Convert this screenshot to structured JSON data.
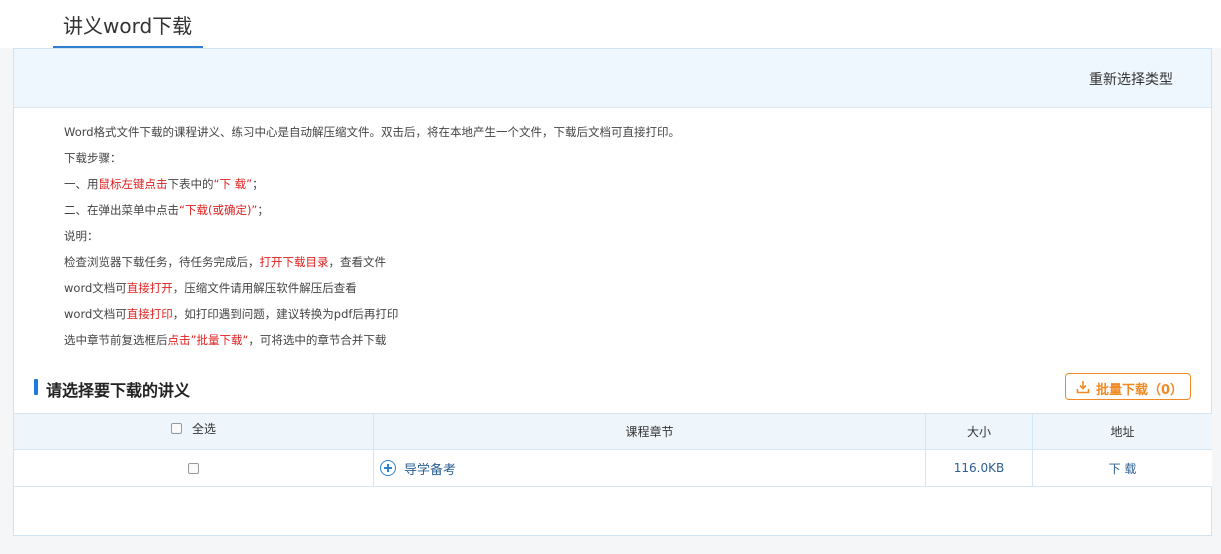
{
  "page": {
    "tab_title": "讲义word下载"
  },
  "header": {
    "reselect_label": "重新选择类型"
  },
  "notes": {
    "intro": "Word格式文件下载的课程讲义、练习中心是自动解压缩文件。双击后，将在本地产生一个文件，下载后文档可直接打印。",
    "steps_title": "下载步骤：",
    "step1_a": "一、用",
    "step1_red": "鼠标左键点击",
    "step1_b": "下表中的",
    "step1_red2": "“下 载”",
    "step1_c": "；",
    "step2_a": "二、在弹出菜单中点击",
    "step2_red": "“下载(或确定)”",
    "step2_b": "；",
    "explain_title": "说明：",
    "explain1_a": "检查浏览器下载任务，待任务完成后，",
    "explain1_red": "打开下载目录",
    "explain1_b": "，查看文件",
    "explain2_a": "word文档可",
    "explain2_red": "直接打开",
    "explain2_b": "，压缩文件请用解压软件解压后查看",
    "explain3_a": "word文档可",
    "explain3_red": "直接打印",
    "explain3_b": "，如打印遇到问题，建议转换为pdf后再打印",
    "explain4_a": "选中章节前复选框后",
    "explain4_red": "点击”批量下载“",
    "explain4_b": "，可将选中的章节合并下载"
  },
  "section": {
    "title": "请选择要下载的讲义",
    "batch_label": "批量下载（0）",
    "accent_color": "#f08a24"
  },
  "table": {
    "columns": {
      "select_all": "全选",
      "chapter": "课程章节",
      "size": "大小",
      "address": "地址"
    },
    "rows": [
      {
        "checked": false,
        "chapter": "导学备考",
        "size": "116.0KB",
        "address": "下 载"
      }
    ]
  },
  "icons": {
    "expand": "plus-circle-icon",
    "batch": "download-icon"
  }
}
